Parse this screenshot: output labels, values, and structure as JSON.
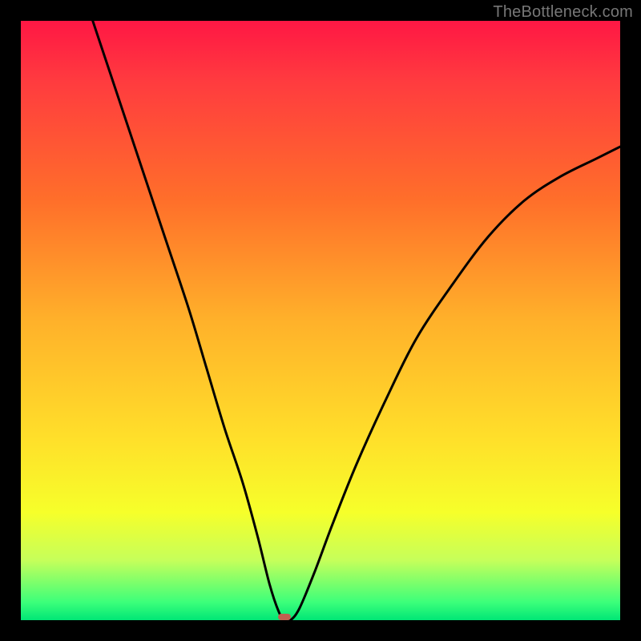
{
  "watermark": "TheBottleneck.com",
  "chart_data": {
    "type": "line",
    "title": "",
    "xlabel": "",
    "ylabel": "",
    "xlim": [
      0,
      1
    ],
    "ylim": [
      0,
      1
    ],
    "min_point": {
      "x": 0.44,
      "y": 0.0
    },
    "marker_color": "#c06050",
    "gradient_stops": [
      {
        "pos": 0.0,
        "color": "#ff1744"
      },
      {
        "pos": 0.1,
        "color": "#ff3b3f"
      },
      {
        "pos": 0.3,
        "color": "#ff6f2a"
      },
      {
        "pos": 0.5,
        "color": "#ffb12a"
      },
      {
        "pos": 0.7,
        "color": "#ffe02a"
      },
      {
        "pos": 0.82,
        "color": "#f6ff2a"
      },
      {
        "pos": 0.9,
        "color": "#c6ff5a"
      },
      {
        "pos": 0.97,
        "color": "#3cff7a"
      },
      {
        "pos": 1.0,
        "color": "#00e676"
      }
    ],
    "curve_points": [
      {
        "x": 0.12,
        "y": 1.0
      },
      {
        "x": 0.16,
        "y": 0.88
      },
      {
        "x": 0.2,
        "y": 0.76
      },
      {
        "x": 0.24,
        "y": 0.64
      },
      {
        "x": 0.28,
        "y": 0.52
      },
      {
        "x": 0.31,
        "y": 0.42
      },
      {
        "x": 0.34,
        "y": 0.32
      },
      {
        "x": 0.37,
        "y": 0.23
      },
      {
        "x": 0.395,
        "y": 0.14
      },
      {
        "x": 0.415,
        "y": 0.06
      },
      {
        "x": 0.43,
        "y": 0.015
      },
      {
        "x": 0.44,
        "y": 0.0
      },
      {
        "x": 0.45,
        "y": 0.0
      },
      {
        "x": 0.465,
        "y": 0.02
      },
      {
        "x": 0.49,
        "y": 0.08
      },
      {
        "x": 0.52,
        "y": 0.16
      },
      {
        "x": 0.56,
        "y": 0.26
      },
      {
        "x": 0.61,
        "y": 0.37
      },
      {
        "x": 0.66,
        "y": 0.47
      },
      {
        "x": 0.72,
        "y": 0.56
      },
      {
        "x": 0.78,
        "y": 0.64
      },
      {
        "x": 0.84,
        "y": 0.7
      },
      {
        "x": 0.9,
        "y": 0.74
      },
      {
        "x": 0.96,
        "y": 0.77
      },
      {
        "x": 1.0,
        "y": 0.79
      }
    ]
  }
}
